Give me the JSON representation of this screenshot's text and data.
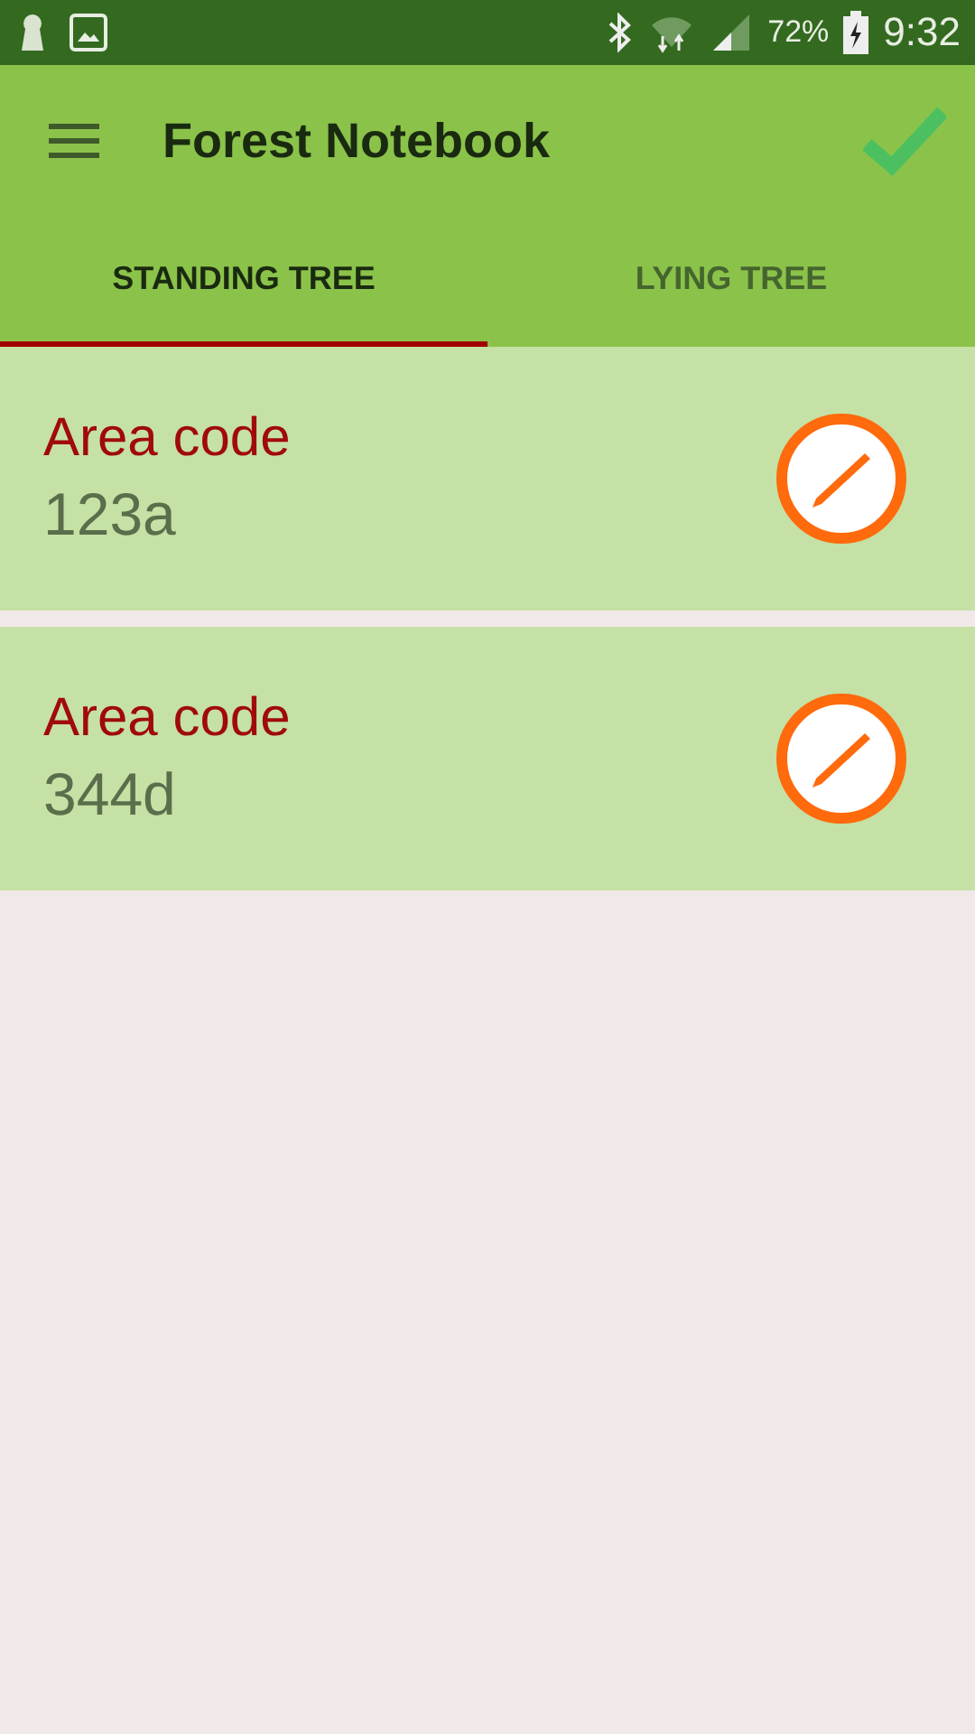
{
  "status_bar": {
    "battery": "72%",
    "time": "9:32"
  },
  "app_bar": {
    "title": "Forest Notebook"
  },
  "tabs": [
    {
      "label": "STANDING TREE",
      "selected": true
    },
    {
      "label": "LYING TREE",
      "selected": false
    }
  ],
  "items": [
    {
      "label": "Area code",
      "value": "123a"
    },
    {
      "label": "Area code",
      "value": "344d"
    }
  ]
}
